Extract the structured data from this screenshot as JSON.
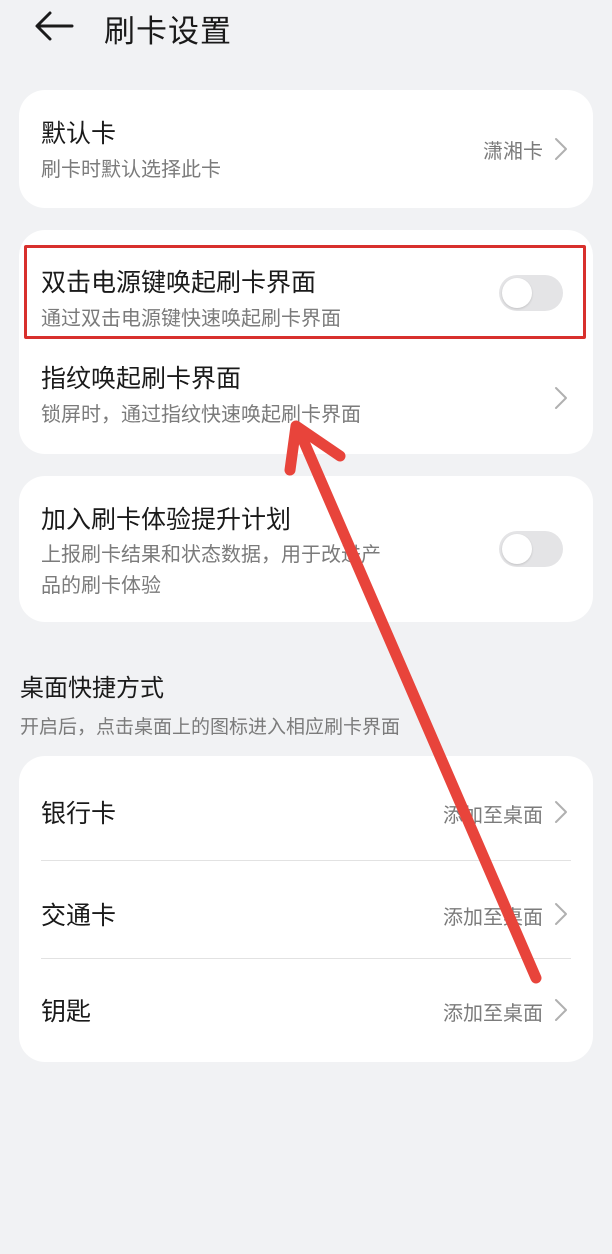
{
  "header": {
    "title": "刷卡设置",
    "back_icon": "arrow-left-icon"
  },
  "card_default": {
    "title": "默认卡",
    "subtitle": "刷卡时默认选择此卡",
    "value": "潇湘卡"
  },
  "card_wake": {
    "double_press": {
      "title": "双击电源键唤起刷卡界面",
      "subtitle": "通过双击电源键快速唤起刷卡界面",
      "toggle_on": false
    },
    "fingerprint": {
      "title": "指纹唤起刷卡界面",
      "subtitle": "锁屏时，通过指纹快速唤起刷卡界面"
    }
  },
  "card_experience": {
    "title": "加入刷卡体验提升计划",
    "subtitle_line1": "上报刷卡结果和状态数据，用于改进产",
    "subtitle_line2": "品的刷卡体验",
    "toggle_on": false
  },
  "shortcuts": {
    "title": "桌面快捷方式",
    "subtitle": "开启后，点击桌面上的图标进入相应刷卡界面",
    "items": [
      {
        "label": "银行卡",
        "action": "添加至桌面"
      },
      {
        "label": "交通卡",
        "action": "添加至桌面"
      },
      {
        "label": "钥匙",
        "action": "添加至桌面"
      }
    ]
  },
  "colors": {
    "background": "#f1f2f4",
    "card": "#ffffff",
    "annotation_red": "#d8302d",
    "toggle_off": "#e4e4e6"
  }
}
